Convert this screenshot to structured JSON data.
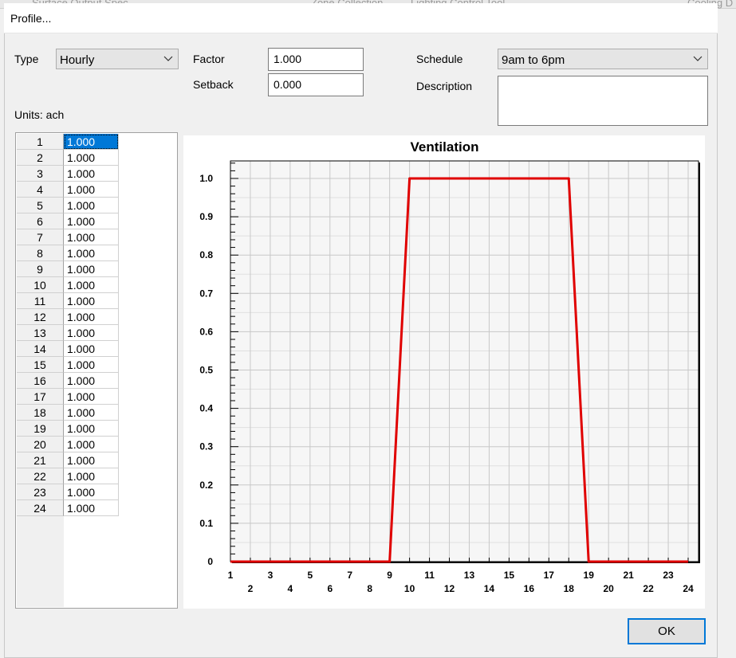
{
  "background": {
    "labels": [
      "Surface Output Spec",
      "Zone Collection",
      "Lighting Control Tool",
      "Cooling D"
    ]
  },
  "dialog": {
    "title": "Profile..."
  },
  "form": {
    "type_label": "Type",
    "type_value": "Hourly",
    "factor_label": "Factor",
    "factor_value": "1.000",
    "setback_label": "Setback",
    "setback_value": "0.000",
    "schedule_label": "Schedule",
    "schedule_value": "9am to 6pm",
    "description_label": "Description",
    "description_value": "",
    "units_label": "Units: ach"
  },
  "table": {
    "selected_row": 1,
    "rows": [
      {
        "hour": "1",
        "value": "1.000"
      },
      {
        "hour": "2",
        "value": "1.000"
      },
      {
        "hour": "3",
        "value": "1.000"
      },
      {
        "hour": "4",
        "value": "1.000"
      },
      {
        "hour": "5",
        "value": "1.000"
      },
      {
        "hour": "6",
        "value": "1.000"
      },
      {
        "hour": "7",
        "value": "1.000"
      },
      {
        "hour": "8",
        "value": "1.000"
      },
      {
        "hour": "9",
        "value": "1.000"
      },
      {
        "hour": "10",
        "value": "1.000"
      },
      {
        "hour": "11",
        "value": "1.000"
      },
      {
        "hour": "12",
        "value": "1.000"
      },
      {
        "hour": "13",
        "value": "1.000"
      },
      {
        "hour": "14",
        "value": "1.000"
      },
      {
        "hour": "15",
        "value": "1.000"
      },
      {
        "hour": "16",
        "value": "1.000"
      },
      {
        "hour": "17",
        "value": "1.000"
      },
      {
        "hour": "18",
        "value": "1.000"
      },
      {
        "hour": "19",
        "value": "1.000"
      },
      {
        "hour": "20",
        "value": "1.000"
      },
      {
        "hour": "21",
        "value": "1.000"
      },
      {
        "hour": "22",
        "value": "1.000"
      },
      {
        "hour": "23",
        "value": "1.000"
      },
      {
        "hour": "24",
        "value": "1.000"
      }
    ]
  },
  "chart_data": {
    "type": "line",
    "title": "Ventilation",
    "xlabel": "",
    "ylabel": "",
    "xlim": [
      1,
      24
    ],
    "ylim": [
      0,
      1.05
    ],
    "grid": true,
    "line_color": "#e00000",
    "x": [
      1,
      9,
      10,
      18,
      19,
      24
    ],
    "y": [
      0,
      0,
      1,
      1,
      0,
      0
    ],
    "x_ticks_odd": [
      "1",
      "3",
      "5",
      "7",
      "9",
      "11",
      "13",
      "15",
      "17",
      "19",
      "21",
      "23"
    ],
    "x_ticks_even": [
      "2",
      "4",
      "6",
      "8",
      "10",
      "12",
      "14",
      "16",
      "18",
      "20",
      "22",
      "24"
    ],
    "y_ticks": [
      "0",
      "0.1",
      "0.2",
      "0.3",
      "0.4",
      "0.5",
      "0.6",
      "0.7",
      "0.8",
      "0.9",
      "1.0"
    ]
  },
  "footer": {
    "ok_label": "OK"
  },
  "colors": {
    "accent": "#0078d7",
    "series": "#e00000"
  }
}
